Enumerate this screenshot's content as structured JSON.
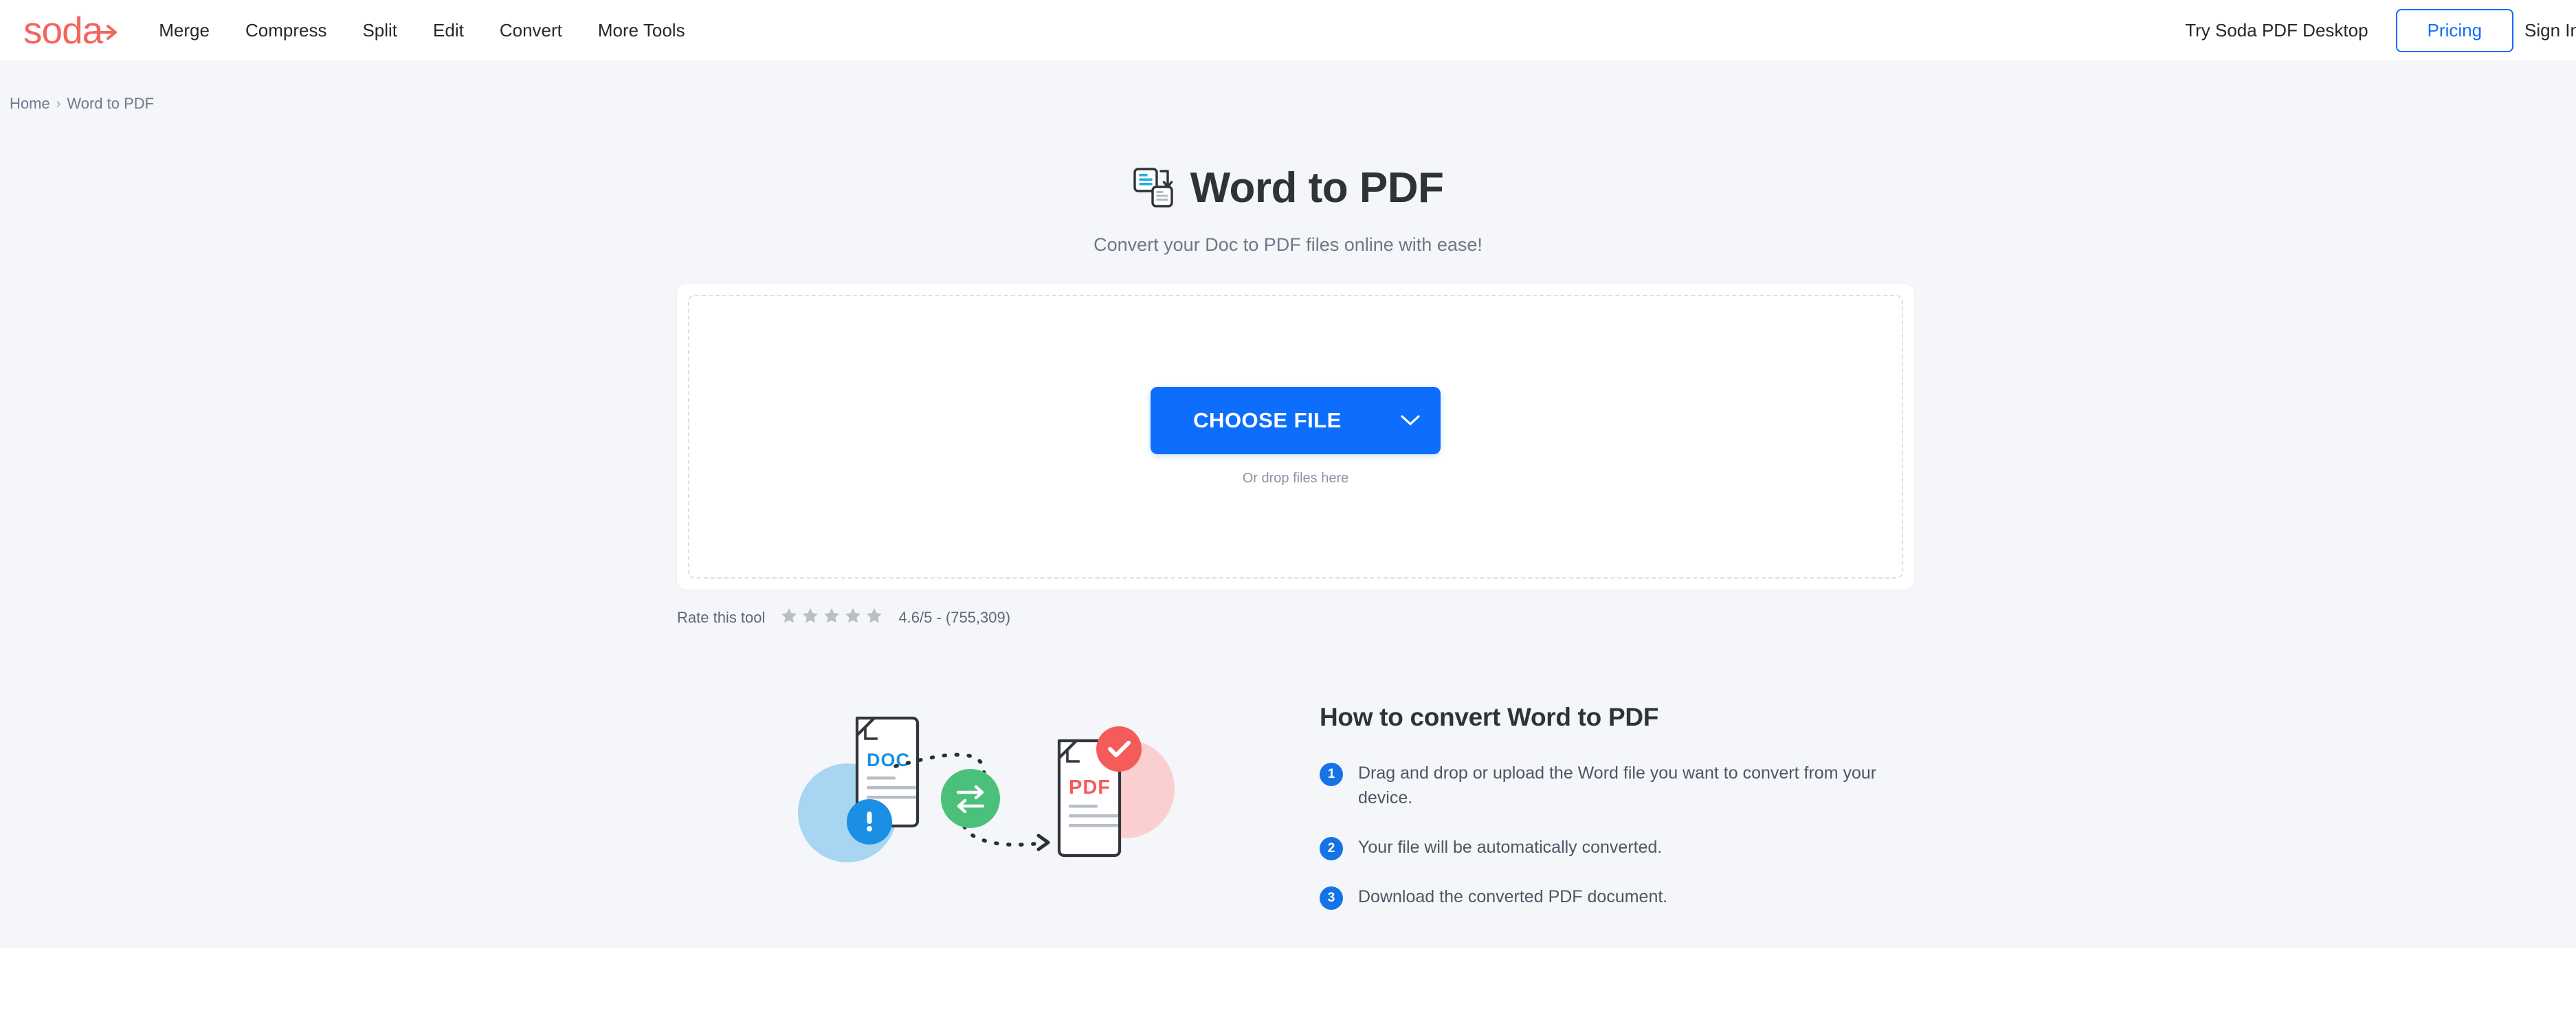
{
  "header": {
    "logo_text": "soda",
    "logo_icon": "arrow-right-icon",
    "nav": [
      {
        "label": "Merge",
        "name": "nav-merge"
      },
      {
        "label": "Compress",
        "name": "nav-compress"
      },
      {
        "label": "Split",
        "name": "nav-split"
      },
      {
        "label": "Edit",
        "name": "nav-edit"
      },
      {
        "label": "Convert",
        "name": "nav-convert"
      },
      {
        "label": "More Tools",
        "name": "nav-more-tools"
      }
    ],
    "desktop_link": "Try Soda PDF Desktop",
    "pricing_label": "Pricing",
    "signin_label": "Sign In"
  },
  "breadcrumb": {
    "home": "Home",
    "separator": "›",
    "current": "Word to PDF"
  },
  "hero": {
    "title": "Word to PDF",
    "title_icon": "word-to-pdf-convert-icon",
    "subtitle": "Convert your Doc to PDF files online with ease!"
  },
  "upload": {
    "choose_label": "CHOOSE FILE",
    "caret_icon": "chevron-down-icon",
    "drop_hint": "Or drop files here"
  },
  "rating": {
    "label": "Rate this tool",
    "stars": 5,
    "score": "4.6/5 - (755,309)"
  },
  "howto": {
    "title": "How to convert Word to PDF",
    "steps": [
      {
        "num": "1",
        "text": "Drag and drop or upload the Word file you want to convert from your device."
      },
      {
        "num": "2",
        "text": "Your file will be automatically converted."
      },
      {
        "num": "3",
        "text": "Download the converted PDF document."
      }
    ]
  },
  "illustration": {
    "source_label": "DOC",
    "target_label": "PDF",
    "source_badge_icon": "exclamation-badge-icon",
    "target_badge_icon": "check-badge-icon",
    "middle_icon": "exchange-arrows-icon"
  },
  "colors": {
    "brand_red": "#f4645f",
    "primary_blue": "#0d6efd",
    "page_bg": "#f4f6fa",
    "doc_blue": "#1a8fe3",
    "pdf_red": "#f45b5b",
    "convert_green": "#4bc07a",
    "text_dark": "#2f3237",
    "text_muted": "#6f7787"
  }
}
